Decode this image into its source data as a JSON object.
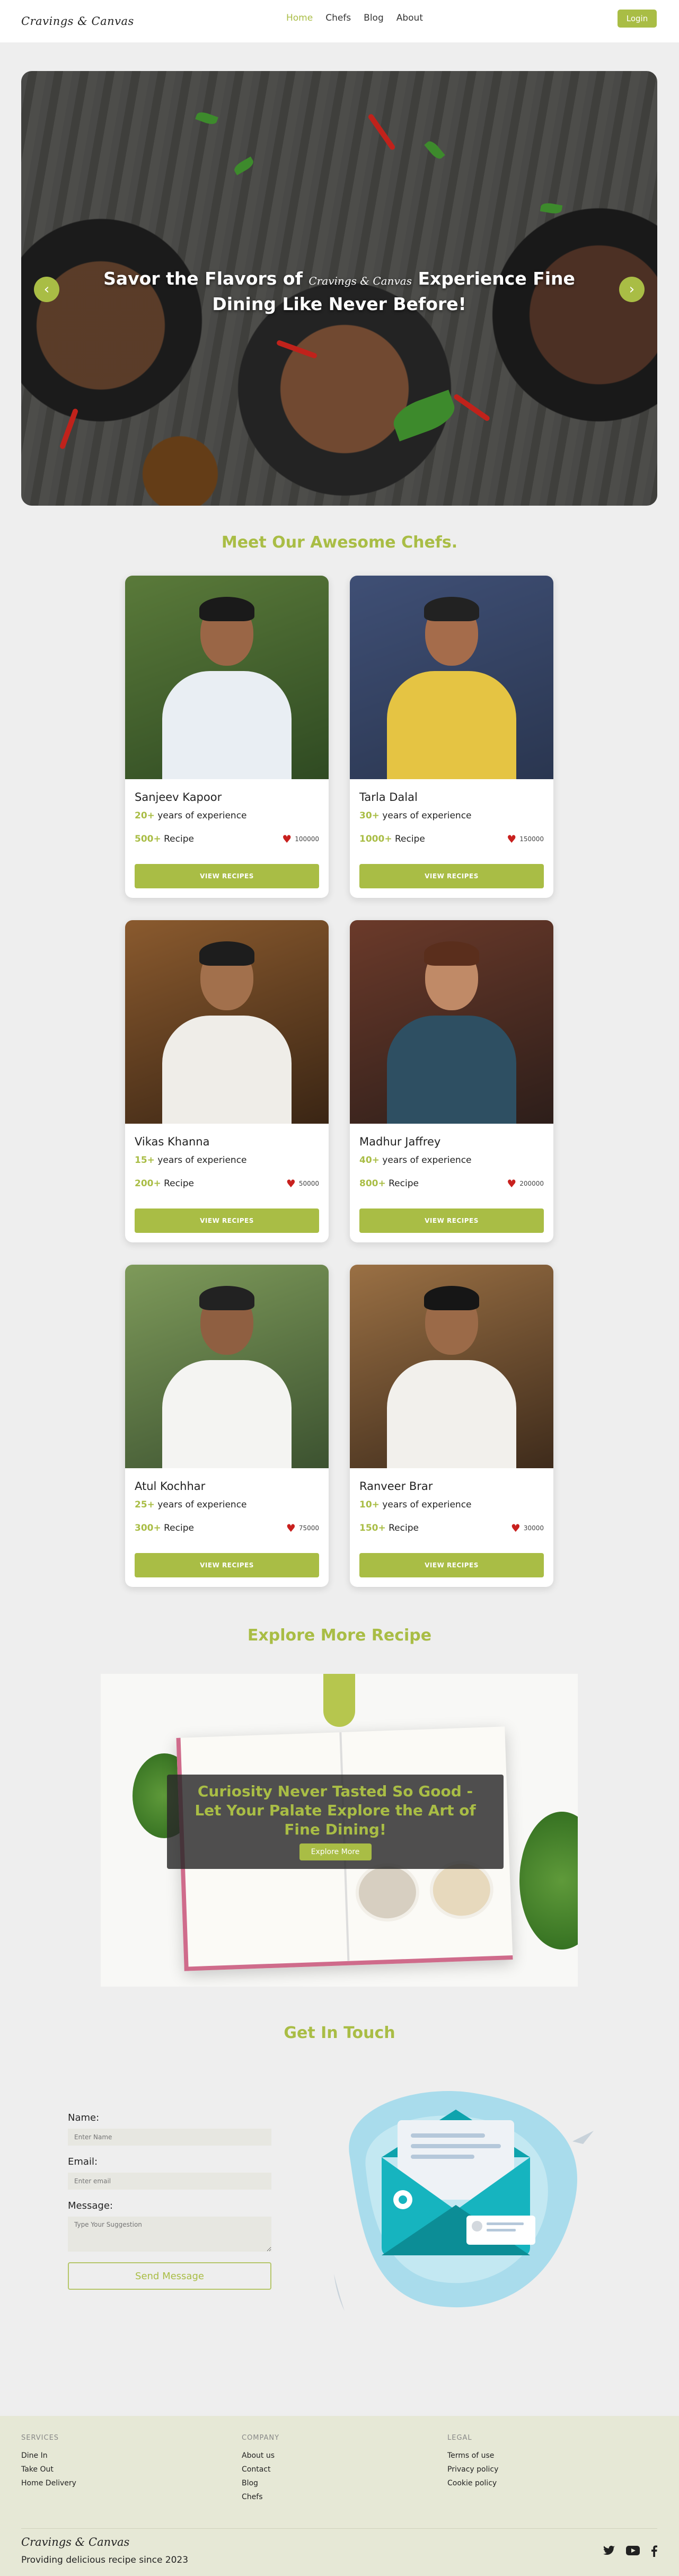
{
  "brand": "Cravings & Canvas",
  "nav": {
    "items": [
      {
        "label": "Home",
        "active": true
      },
      {
        "label": "Chefs",
        "active": false
      },
      {
        "label": "Blog",
        "active": false
      },
      {
        "label": "About",
        "active": false
      }
    ],
    "login_label": "Login"
  },
  "hero": {
    "title_start": "Savor the Flavors of",
    "title_brand": "Cravings & Canvas",
    "title_end": "Experience Fine Dining Like Never Before!",
    "prev_icon": "chevron-left-icon",
    "next_icon": "chevron-right-icon"
  },
  "chefs_section": {
    "title": "Meet Our Awesome Chefs.",
    "years_suffix": " years of experience",
    "recipe_suffix": " Recipe",
    "button_label": "VIEW RECIPES",
    "heart_icon": "heart-icon",
    "chefs": [
      {
        "name": "Sanjeev Kapoor",
        "years": "20+",
        "recipes": "500+",
        "likes": "100000"
      },
      {
        "name": "Tarla Dalal",
        "years": "30+",
        "recipes": "1000+",
        "likes": "150000"
      },
      {
        "name": "Vikas Khanna",
        "years": "15+",
        "recipes": "200+",
        "likes": "50000"
      },
      {
        "name": "Madhur Jaffrey",
        "years": "40+",
        "recipes": "800+",
        "likes": "200000"
      },
      {
        "name": "Atul Kochhar",
        "years": "25+",
        "recipes": "300+",
        "likes": "75000"
      },
      {
        "name": "Ranveer Brar",
        "years": "10+",
        "recipes": "150+",
        "likes": "30000"
      }
    ]
  },
  "explore": {
    "title": "Explore More Recipe",
    "heading": "Curiosity Never Tasted So Good - Let Your Palate Explore the Art of Fine Dining!",
    "button_label": "Explore More"
  },
  "contact": {
    "title": "Get In Touch",
    "name_label": "Name:",
    "name_placeholder": "Enter Name",
    "email_label": "Email:",
    "email_placeholder": "Enter email",
    "message_label": "Message:",
    "message_placeholder": "Type Your Suggestion",
    "send_label": "Send Message"
  },
  "footer": {
    "services": {
      "heading": "SERVICES",
      "links": [
        "Dine In",
        "Take Out",
        "Home Delivery"
      ]
    },
    "company": {
      "heading": "COMPANY",
      "links": [
        "About us",
        "Contact",
        "Blog",
        "Chefs"
      ]
    },
    "legal": {
      "heading": "LEGAL",
      "links": [
        "Terms of use",
        "Privacy policy",
        "Cookie policy"
      ]
    },
    "brand": "Cravings & Canvas",
    "tagline": "Providing delicious recipe since 2023",
    "social_icons": [
      "twitter-icon",
      "youtube-icon",
      "facebook-icon"
    ]
  },
  "colors": {
    "accent": "#a9bd45",
    "heart": "#c8201e",
    "page_bg": "#eeeeee",
    "footer_bg": "#e6e8d6"
  }
}
